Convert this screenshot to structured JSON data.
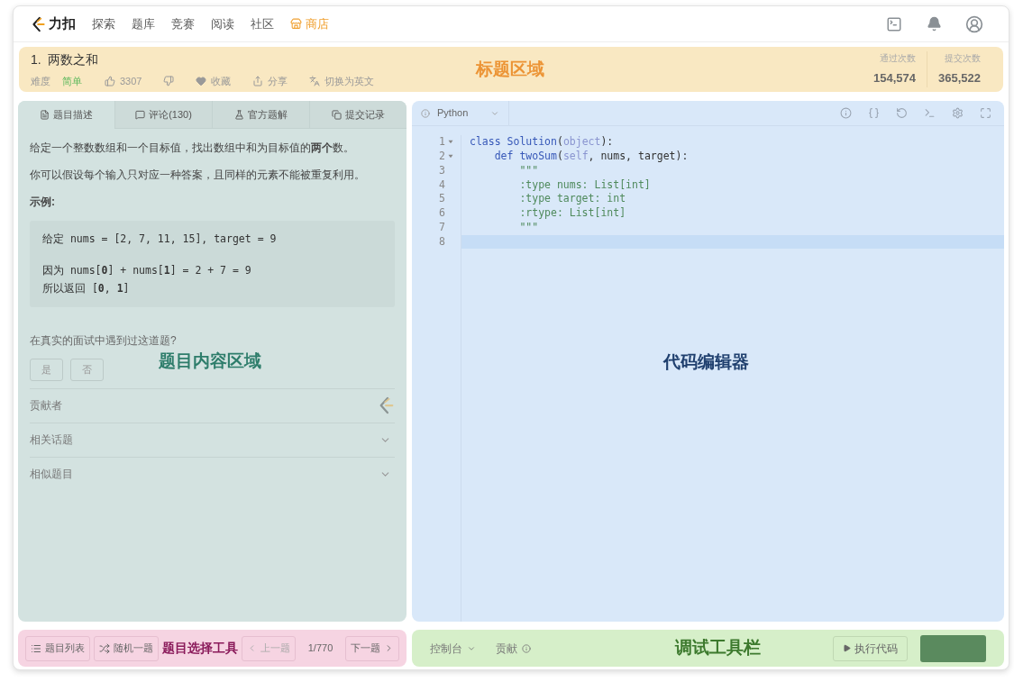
{
  "nav": {
    "logo_text": "力扣",
    "items": [
      {
        "label": "探索",
        "kind": "link"
      },
      {
        "label": "题库",
        "kind": "link"
      },
      {
        "label": "竞赛",
        "kind": "link"
      },
      {
        "label": "阅读",
        "kind": "link"
      },
      {
        "label": "社区",
        "kind": "link"
      },
      {
        "label": "商店",
        "kind": "store"
      }
    ]
  },
  "header": {
    "region_label": "标题区域",
    "title": "1.  两数之和",
    "difficulty_label": "难度",
    "difficulty": "简单",
    "actions": [
      {
        "kind": "like",
        "label": "3307"
      },
      {
        "kind": "dislike"
      },
      {
        "kind": "favorite",
        "label": "收藏"
      },
      {
        "kind": "share",
        "label": "分享"
      },
      {
        "kind": "translate",
        "label": "切换为英文"
      }
    ],
    "stats": [
      {
        "label": "通过次数",
        "value": "154,574"
      },
      {
        "label": "提交次数",
        "value": "365,522"
      }
    ]
  },
  "problem": {
    "tabs": [
      {
        "label": "题目描述",
        "kind": "description",
        "selected": true
      },
      {
        "label": "评论(130)",
        "kind": "comments",
        "selected": false
      },
      {
        "label": "官方题解",
        "kind": "solution",
        "selected": false
      },
      {
        "label": "提交记录",
        "kind": "submissions",
        "selected": false
      }
    ],
    "paragraphs": [
      "给定一个整数数组和一个目标值，找出数组中和为目标值的**两个**数。",
      "你可以假设每个输入只对应一种答案，且同样的元素不能被重复利用。"
    ],
    "example_heading": "示例:",
    "example_blocks": [
      [
        "给定 nums = [2, 7, 11, 15], target = 9"
      ],
      [
        "因为 nums[**0**] + nums[**1**] = 2 + 7 = 9",
        "所以返回 [**0**, **1**]"
      ]
    ],
    "question": "在真实的面试中遇到过这道题?",
    "answers": [
      "是",
      "否"
    ],
    "region_label": "题目内容区域",
    "sections": [
      {
        "label": "贡献者",
        "kind": "contributor"
      },
      {
        "label": "相关话题",
        "kind": "collapsible",
        "expanded": false
      },
      {
        "label": "相似题目",
        "kind": "collapsible",
        "expanded": false
      }
    ]
  },
  "editor": {
    "language": "Python",
    "tools": [
      {
        "kind": "info"
      },
      {
        "kind": "braces"
      },
      {
        "kind": "reset"
      },
      {
        "kind": "terminal"
      },
      {
        "kind": "settings"
      },
      {
        "kind": "fullscreen"
      }
    ],
    "region_label": "代码编辑器",
    "lines": [
      {
        "number": "1",
        "foldable": true,
        "current": false,
        "tokens": [
          {
            "t": "class ",
            "kind": "keyword"
          },
          {
            "t": "Solution",
            "kind": "name"
          },
          {
            "t": "(",
            "kind": "plain"
          },
          {
            "t": "object",
            "kind": "builtin"
          },
          {
            "t": "):",
            "kind": "plain"
          }
        ]
      },
      {
        "number": "2",
        "foldable": true,
        "current": false,
        "tokens": [
          {
            "t": "    def ",
            "kind": "keyword"
          },
          {
            "t": "twoSum",
            "kind": "name"
          },
          {
            "t": "(",
            "kind": "plain"
          },
          {
            "t": "self",
            "kind": "builtin"
          },
          {
            "t": ", nums, target):",
            "kind": "plain"
          }
        ]
      },
      {
        "number": "3",
        "foldable": false,
        "current": false,
        "tokens": [
          {
            "t": "        \"\"\"",
            "kind": "string"
          }
        ]
      },
      {
        "number": "4",
        "foldable": false,
        "current": false,
        "tokens": [
          {
            "t": "        :type nums: List[int]",
            "kind": "string"
          }
        ]
      },
      {
        "number": "5",
        "foldable": false,
        "current": false,
        "tokens": [
          {
            "t": "        :type target: int",
            "kind": "string"
          }
        ]
      },
      {
        "number": "6",
        "foldable": false,
        "current": false,
        "tokens": [
          {
            "t": "        :rtype: List[int]",
            "kind": "string"
          }
        ]
      },
      {
        "number": "7",
        "foldable": false,
        "current": false,
        "tokens": [
          {
            "t": "        \"\"\"",
            "kind": "string"
          }
        ]
      },
      {
        "number": "8",
        "foldable": false,
        "current": true
      }
    ]
  },
  "picker": {
    "items": [
      {
        "kind": "list_button",
        "label": "题目列表"
      },
      {
        "kind": "random_button",
        "label": "随机一题"
      },
      {
        "kind": "region_label",
        "label": "题目选择工具"
      },
      {
        "kind": "prev_button",
        "label": "上一题"
      },
      {
        "kind": "counter",
        "label": "1/770"
      },
      {
        "kind": "next_button",
        "label": "下一题"
      }
    ]
  },
  "debug": {
    "console": "控制台",
    "contribute": "贡献",
    "region_label": "调试工具栏",
    "run": "执行代码"
  }
}
